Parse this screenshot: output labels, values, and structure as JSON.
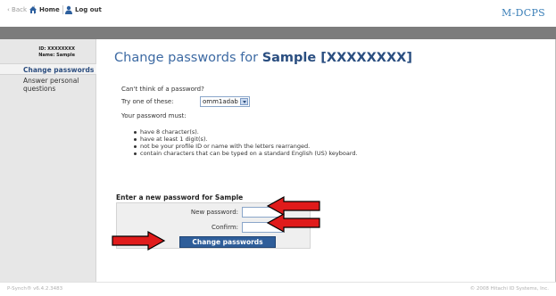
{
  "nav": {
    "back_label": "Back",
    "home_label": "Home",
    "logout_label": "Log out",
    "brand": "M-DCPS",
    "brand_color": "#3a7fb8"
  },
  "sidebar": {
    "id_line": "ID: XXXXXXXX",
    "name_line": "Name: Sample",
    "items": [
      {
        "label": "Change passwords",
        "active": true
      },
      {
        "label": "Answer personal questions",
        "active": false
      }
    ]
  },
  "main": {
    "title_prefix": "Change passwords for",
    "title_subject": "Sample [XXXXXXXX]",
    "hint_cant_think": "Can't think of a password?",
    "try_label": "Try one of these:",
    "suggestion_value": "omm1adab",
    "must_label": "Your password must:",
    "rules": [
      "have 8 character(s).",
      "have at least 1 digit(s).",
      "not be your profile ID or name with the letters rearranged.",
      "contain characters that can be typed on a standard English (US) keyboard."
    ]
  },
  "form": {
    "heading": "Enter a new password for Sample",
    "new_password_label": "New password:",
    "new_password_value": "",
    "confirm_label": "Confirm:",
    "confirm_value": "",
    "submit_label": "Change passwords",
    "accent_color": "#2f5e9a"
  },
  "annotations": {
    "arrow_color": "#e01b1b",
    "arrow_outline": "#000000"
  },
  "footer": {
    "version": "P-Synch® v6.4.2.3483",
    "copyright": "© 2008 Hitachi ID Systems, Inc."
  }
}
